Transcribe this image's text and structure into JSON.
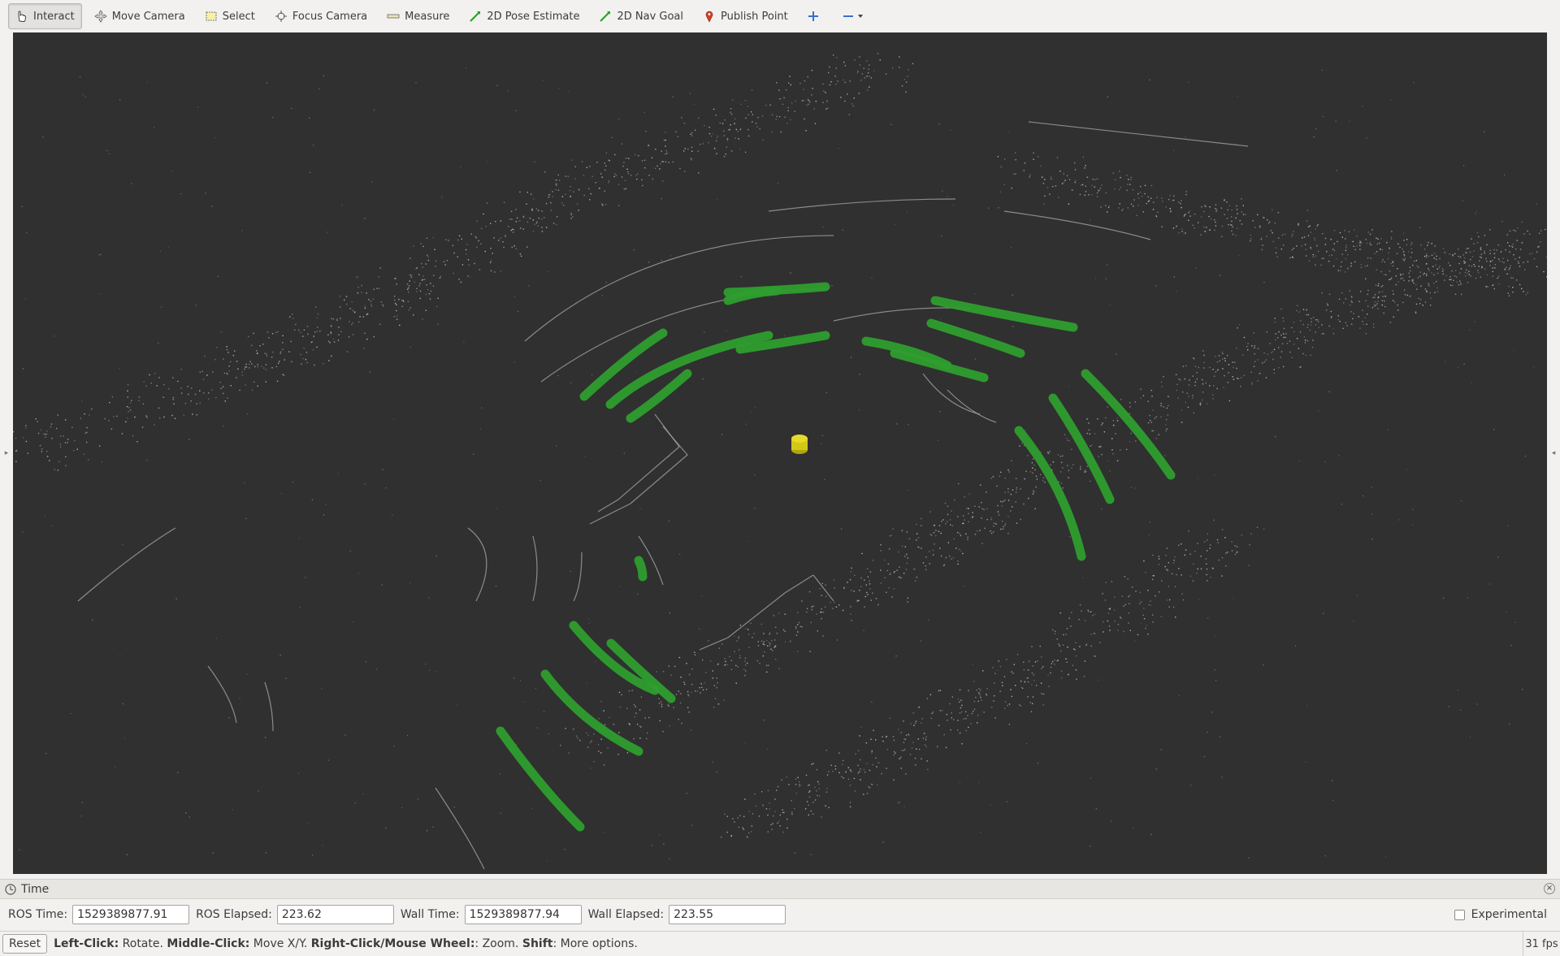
{
  "toolbar": {
    "tools": [
      {
        "label": "Interact",
        "icon": "hand-icon",
        "active": true
      },
      {
        "label": "Move Camera",
        "icon": "move-camera-icon"
      },
      {
        "label": "Select",
        "icon": "select-box-icon"
      },
      {
        "label": "Focus Camera",
        "icon": "focus-target-icon"
      },
      {
        "label": "Measure",
        "icon": "ruler-icon"
      },
      {
        "label": "2D Pose Estimate",
        "icon": "green-arrow-icon"
      },
      {
        "label": "2D Nav Goal",
        "icon": "green-arrow-icon"
      },
      {
        "label": "Publish Point",
        "icon": "map-pin-icon"
      }
    ],
    "add_tool_icon": "plus-icon",
    "remove_tool_icon": "minus-icon"
  },
  "viewport": {
    "background_color": "#303030",
    "cluster_color": "#2e9e2e",
    "robot_color": "#d4c816",
    "cloud_color": "#bdbdbd"
  },
  "time_panel": {
    "title": "Time",
    "ros_time_label": "ROS Time:",
    "ros_time_value": "1529389877.91",
    "ros_elapsed_label": "ROS Elapsed:",
    "ros_elapsed_value": "223.62",
    "wall_time_label": "Wall Time:",
    "wall_time_value": "1529389877.94",
    "wall_elapsed_label": "Wall Elapsed:",
    "wall_elapsed_value": "223.55",
    "experimental_label": "Experimental"
  },
  "status_bar": {
    "reset_label": "Reset",
    "left_click": "Left-Click:",
    "left_click_action": " Rotate. ",
    "middle_click": "Middle-Click:",
    "middle_click_action": " Move X/Y. ",
    "right_click": "Right-Click/Mouse Wheel:",
    "right_click_action": ": Zoom. ",
    "shift": "Shift",
    "shift_action": ": More options.",
    "fps": "31 fps"
  }
}
